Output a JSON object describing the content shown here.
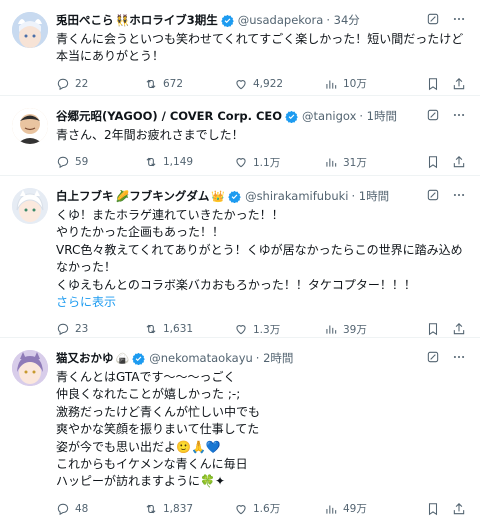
{
  "tweets": [
    {
      "name": "兎田ぺこら",
      "name_suffix": "ホロライブ3期生",
      "badge_emoji": "👯",
      "handle": "@usadapekora",
      "time": "· 34分",
      "text": "青くんに会うといつも笑わせてくれてすごく楽しかった！短い間だったけど本当にありがとう！",
      "more": "",
      "replies": "22",
      "retweets": "672",
      "likes": "4,922",
      "views": "10万",
      "avatar_color": "#b7cde8"
    },
    {
      "name": "谷郷元昭(YAGOO) / COVER Corp. CEO",
      "name_suffix": "",
      "badge_emoji": "",
      "handle": "@tanigox",
      "time": "· 1時間",
      "text": "青さん、2年間お疲れさまでした！",
      "more": "",
      "replies": "59",
      "retweets": "1,149",
      "likes": "1.1万",
      "views": "31万",
      "avatar_color": "#e9c9a8"
    },
    {
      "name": "白上フブキ",
      "name_suffix": "フブキングダム",
      "badge_emoji": "🌽",
      "badge_emoji2": "👑",
      "handle": "@shirakamifubuki",
      "time": "· 1時間",
      "text": "くゆ！またホラゲ連れていきたかった！！\nやりたかった企画もあった！！\nVRC色々教えてくれてありがとう！くゆが居なかったらこの世界に踏み込めなかった！\nくゆえもんとのコラボ楽バカおもろかった！！タケコプター！！！",
      "more": "さらに表示",
      "replies": "23",
      "retweets": "1,631",
      "likes": "1.3万",
      "views": "39万",
      "avatar_color": "#dfe6f0"
    },
    {
      "name": "猫又おかゆ",
      "name_suffix": "",
      "badge_emoji": "🍙",
      "handle": "@nekomataokayu",
      "time": "· 2時間",
      "text": "青くんとはGTAです〜〜〜っごく\n仲良くなれたことが嬉しかった ;-;\n激務だったけど青くんが忙しい中でも\n爽やかな笑顔を振りまいて仕事してた\n姿が今でも思い出だよ🙂🙏💙\nこれからもイケメンな青くんに毎日\nハッピーが訪れますように🍀✦",
      "more": "",
      "replies": "48",
      "retweets": "1,837",
      "likes": "1.6万",
      "views": "49万",
      "avatar_color": "#c9b8e0"
    }
  ],
  "colors": {
    "verified": "#1d9bf0",
    "muted": "#536471",
    "link": "#1d9bf0"
  },
  "icons": [
    "grok-icon",
    "more-icon",
    "reply-icon",
    "retweet-icon",
    "like-icon",
    "views-icon",
    "bookmark-icon",
    "share-icon"
  ]
}
